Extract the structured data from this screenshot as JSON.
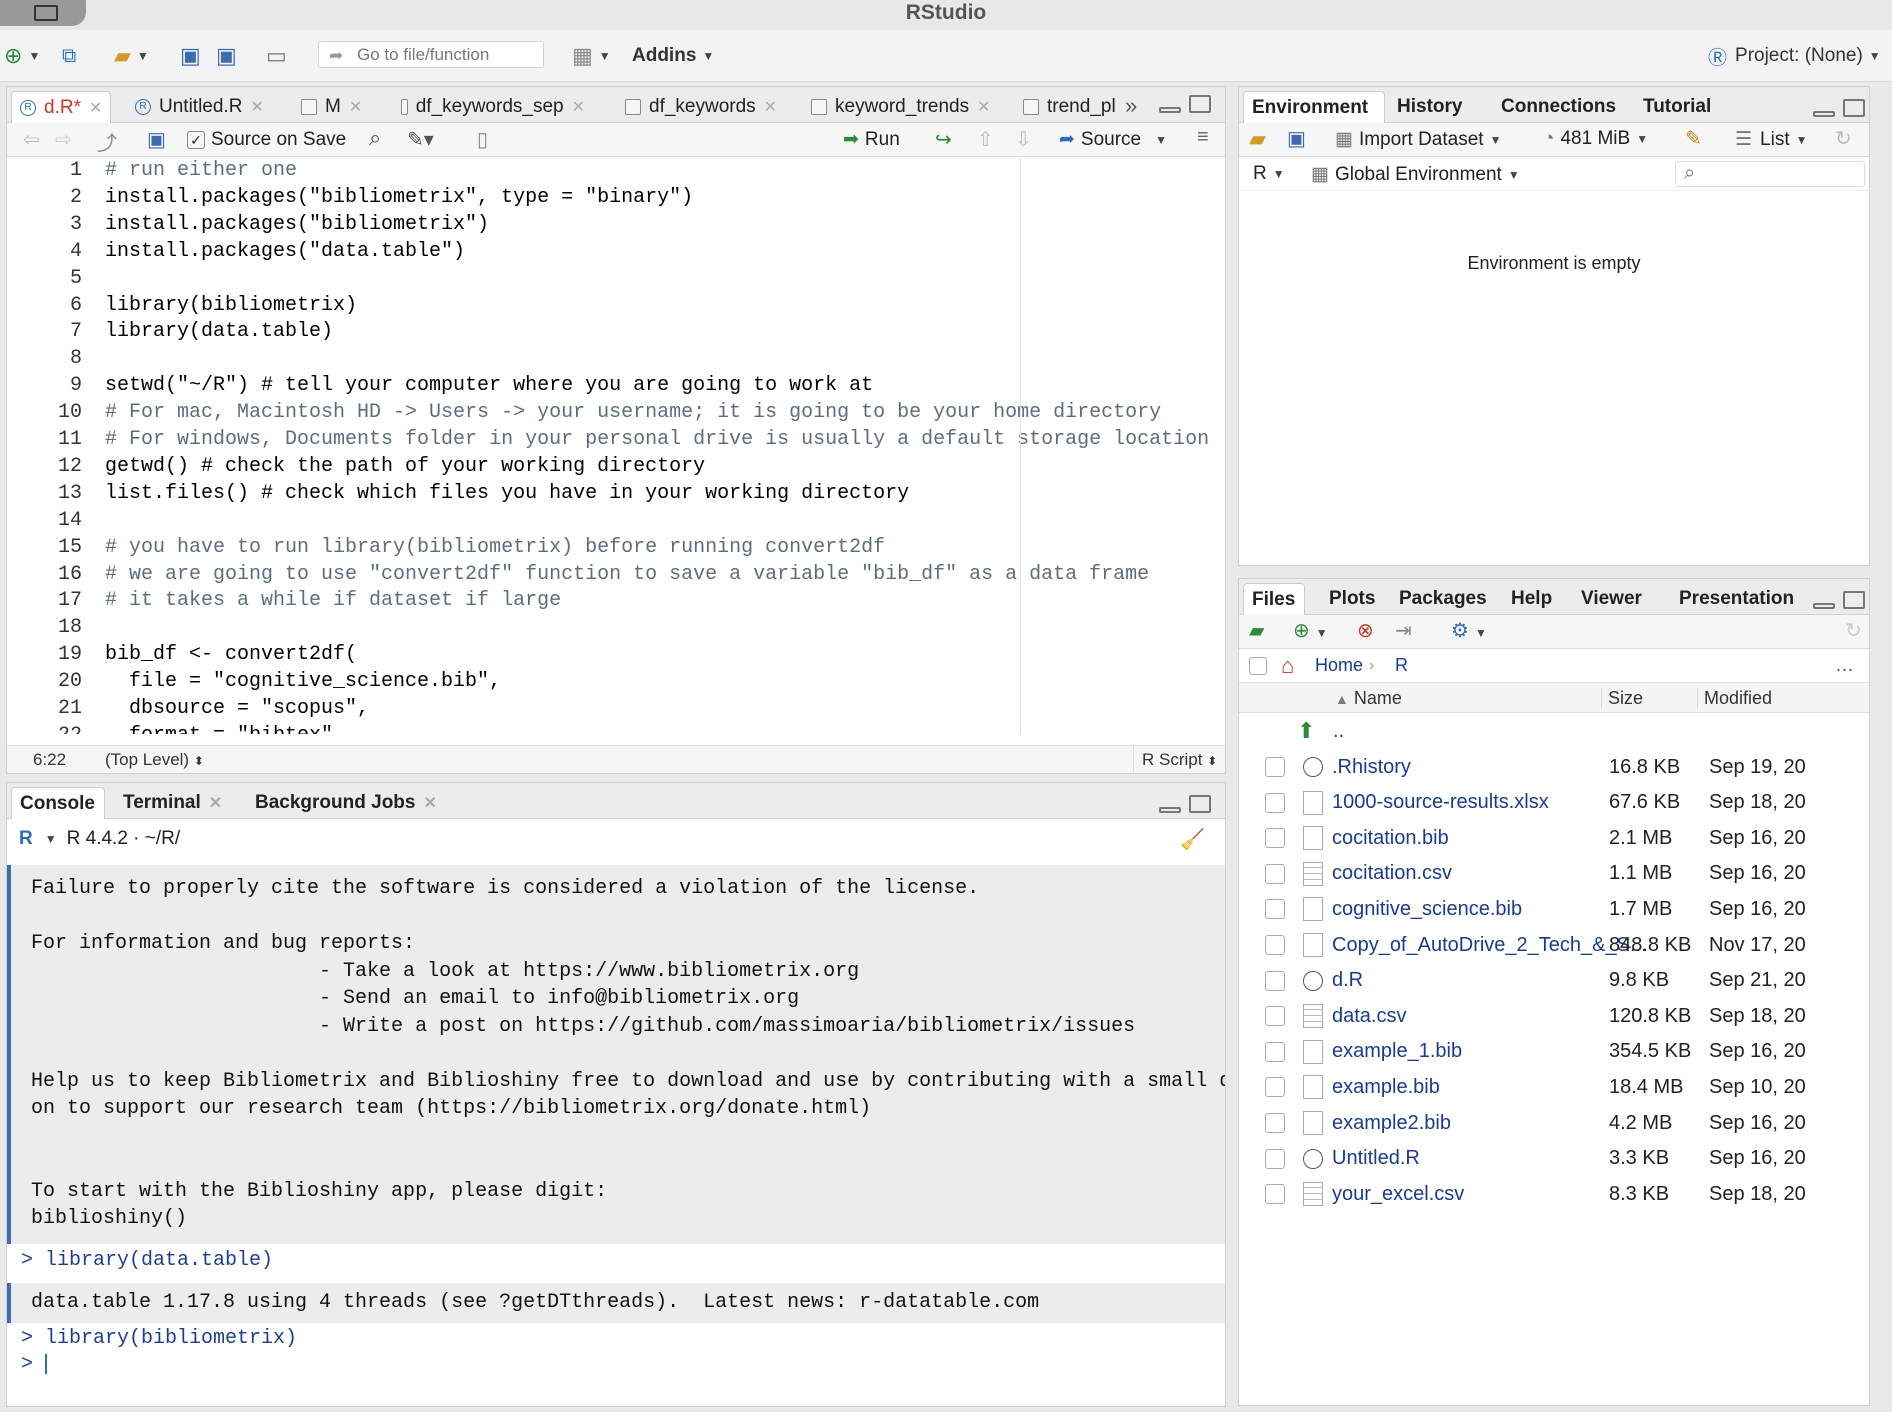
{
  "app": {
    "title": "RStudio"
  },
  "main_toolbar": {
    "goto_placeholder": "Go to file/function",
    "addins_label": "Addins",
    "project_label": "Project: (None)"
  },
  "editor": {
    "tabs": [
      {
        "label": "d.R*"
      },
      {
        "label": "Untitled.R"
      },
      {
        "label": "M"
      },
      {
        "label": "df_keywords_sep"
      },
      {
        "label": "df_keywords"
      },
      {
        "label": "keyword_trends"
      },
      {
        "label": "trend_pl"
      }
    ],
    "source_on_save": "Source on Save",
    "run_label": "Run",
    "source_label": "Source",
    "lines": [
      {
        "n": "1",
        "text": "# run either one",
        "type": "comment"
      },
      {
        "n": "2",
        "text": "install.packages(\"bibliometrix\", type = \"binary\")",
        "type": "code"
      },
      {
        "n": "3",
        "text": "install.packages(\"bibliometrix\")",
        "type": "code"
      },
      {
        "n": "4",
        "text": "install.packages(\"data.table\")",
        "type": "code"
      },
      {
        "n": "5",
        "text": "",
        "type": "code"
      },
      {
        "n": "6",
        "text": "library(bibliometrix)",
        "type": "code"
      },
      {
        "n": "7",
        "text": "library(data.table)",
        "type": "code"
      },
      {
        "n": "8",
        "text": "",
        "type": "code"
      },
      {
        "n": "9",
        "text": "setwd(\"~/R\") # tell your computer where you are going to work at",
        "type": "code"
      },
      {
        "n": "10",
        "text": "# For mac, Macintosh HD -> Users -> your username; it is going to be your home directory",
        "type": "comment"
      },
      {
        "n": "11",
        "text": "# For windows, Documents folder in your personal drive is usually a default storage location",
        "type": "comment"
      },
      {
        "n": "12",
        "text": "getwd() # check the path of your working directory",
        "type": "code"
      },
      {
        "n": "13",
        "text": "list.files() # check which files you have in your working directory",
        "type": "code"
      },
      {
        "n": "14",
        "text": "",
        "type": "code"
      },
      {
        "n": "15",
        "text": "# you have to run library(bibliometrix) before running convert2df",
        "type": "comment"
      },
      {
        "n": "16",
        "text": "# we are going to use \"convert2df\" function to save a variable \"bib_df\" as a data frame",
        "type": "comment"
      },
      {
        "n": "17",
        "text": "# it takes a while if dataset if large",
        "type": "comment"
      },
      {
        "n": "18",
        "text": "",
        "type": "code"
      },
      {
        "n": "19",
        "text": "bib_df <- convert2df(",
        "type": "code"
      },
      {
        "n": "20",
        "text": "  file = \"cognitive_science.bib\",",
        "type": "code"
      },
      {
        "n": "21",
        "text": "  dbsource = \"scopus\",",
        "type": "code"
      },
      {
        "n": "22",
        "text": "  format = \"bibtex\"",
        "type": "code"
      }
    ],
    "status": {
      "position": "6:22",
      "scope": "(Top Level)",
      "filetype": "R Script"
    }
  },
  "console": {
    "tabs": [
      {
        "label": "Console"
      },
      {
        "label": "Terminal"
      },
      {
        "label": "Background Jobs"
      }
    ],
    "r_version": "R 4.4.2 · ~/R/",
    "output_block": [
      "Failure to properly cite the software is considered a violation of the license.",
      "",
      "For information and bug reports:",
      "                        - Take a look at https://www.bibliometrix.org",
      "                        - Send an email to info@bibliometrix.org",
      "                        - Write a post on https://github.com/massimoaria/bibliometrix/issues",
      "",
      "Help us to keep Bibliometrix and Biblioshiny free to download and use by contributing with a small donati",
      "on to support our research team (https://bibliometrix.org/donate.html)",
      "",
      "",
      "To start with the Biblioshiny app, please digit:",
      "biblioshiny()"
    ],
    "cmd1": "> library(data.table)",
    "output2": "data.table 1.17.8 using 4 threads (see ?getDTthreads).  Latest news: r-datatable.com",
    "cmd2": "> library(bibliometrix)",
    "prompt": ">"
  },
  "environment": {
    "tabs": [
      {
        "label": "Environment"
      },
      {
        "label": "History"
      },
      {
        "label": "Connections"
      },
      {
        "label": "Tutorial"
      }
    ],
    "import_dataset": "Import Dataset",
    "memory": "481 MiB",
    "view_mode": "List",
    "language": "R",
    "scope": "Global Environment",
    "empty_message": "Environment is empty"
  },
  "files": {
    "tabs": [
      {
        "label": "Files"
      },
      {
        "label": "Plots"
      },
      {
        "label": "Packages"
      },
      {
        "label": "Help"
      },
      {
        "label": "Viewer"
      },
      {
        "label": "Presentation"
      }
    ],
    "breadcrumb_home": "Home",
    "breadcrumb_dir": "R",
    "columns": {
      "name": "Name",
      "size": "Size",
      "modified": "Modified"
    },
    "parent": "..",
    "rows": [
      {
        "name": ".Rhistory",
        "size": "16.8 KB",
        "modified": "Sep 19, 20",
        "icon": "history-file-icon"
      },
      {
        "name": "1000-source-results.xlsx",
        "size": "67.6 KB",
        "modified": "Sep 18, 20",
        "icon": "file-icon"
      },
      {
        "name": "cocitation.bib",
        "size": "2.1 MB",
        "modified": "Sep 16, 20",
        "icon": "file-icon"
      },
      {
        "name": "cocitation.csv",
        "size": "1.1 MB",
        "modified": "Sep 16, 20",
        "icon": "table-file-icon"
      },
      {
        "name": "cognitive_science.bib",
        "size": "1.7 MB",
        "modified": "Sep 16, 20",
        "icon": "file-icon"
      },
      {
        "name": "Copy_of_AutoDrive_2_Tech_&_S...",
        "size": "848.8 KB",
        "modified": "Nov 17, 20",
        "icon": "file-icon"
      },
      {
        "name": "d.R",
        "size": "9.8 KB",
        "modified": "Sep 21, 20",
        "icon": "r-file-icon"
      },
      {
        "name": "data.csv",
        "size": "120.8 KB",
        "modified": "Sep 18, 20",
        "icon": "table-file-icon"
      },
      {
        "name": "example_1.bib",
        "size": "354.5 KB",
        "modified": "Sep 16, 20",
        "icon": "file-icon"
      },
      {
        "name": "example.bib",
        "size": "18.4 MB",
        "modified": "Sep 10, 20",
        "icon": "file-icon"
      },
      {
        "name": "example2.bib",
        "size": "4.2 MB",
        "modified": "Sep 16, 20",
        "icon": "file-icon"
      },
      {
        "name": "Untitled.R",
        "size": "3.3 KB",
        "modified": "Sep 16, 20",
        "icon": "r-file-icon"
      },
      {
        "name": "your_excel.csv",
        "size": "8.3 KB",
        "modified": "Sep 18, 20",
        "icon": "table-file-icon"
      }
    ]
  }
}
